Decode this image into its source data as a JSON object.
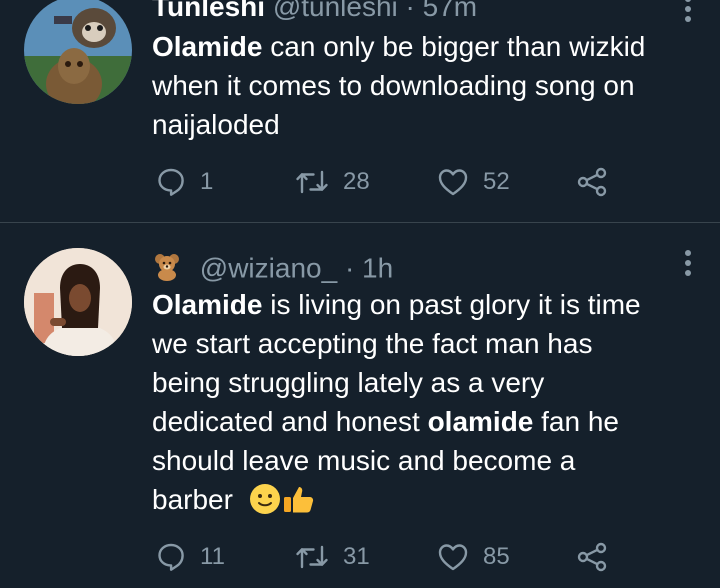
{
  "tweets": [
    {
      "display_name": "Tunleshi",
      "handle": "@tunleshi",
      "separator": "·",
      "time": "57m",
      "avatar_icon": "groot-rocket-avatar",
      "body": {
        "line1_bold": "Olamide",
        "line1_rest": " can only be bigger than wizkid",
        "line2": "when it comes to  downloading song on",
        "line3": "naijaloded"
      },
      "counts": {
        "replies": "1",
        "retweets": "28",
        "likes": "52"
      }
    },
    {
      "name_emoji": "teddy-bear-icon",
      "handle": "@wiziano_",
      "separator": "·",
      "time": "1h",
      "avatar_icon": "woman-dreadlocks-avatar",
      "body": {
        "line1_bold": "Olamide",
        "line1_rest": " is living on past glory it is time",
        "line2": "we start accepting the fact man has",
        "line3": "being struggling lately  as a very",
        "line4_pre": "dedicated and honest ",
        "line4_bold": "olamide",
        "line4_rest": " fan he",
        "line5": "should leave music and become a",
        "line6": "barber",
        "trailing_emojis": [
          "slightly-smiling-face-icon",
          "thumbs-up-icon"
        ]
      },
      "counts": {
        "replies": "11",
        "retweets": "31",
        "likes": "85"
      }
    }
  ],
  "colors": {
    "background": "#15202b",
    "secondary_text": "#8899a6",
    "divider": "#38444d"
  }
}
